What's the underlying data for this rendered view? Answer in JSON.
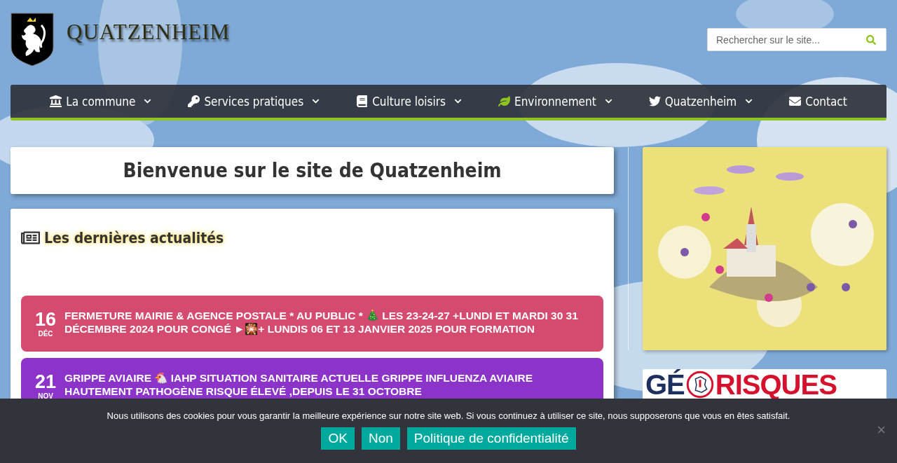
{
  "header": {
    "site_title": "QUATZENHEIM",
    "search": {
      "placeholder": "Rechercher sur le site..."
    }
  },
  "nav": [
    {
      "label": "La commune",
      "dropdown": true
    },
    {
      "label": "Services pratiques",
      "dropdown": true
    },
    {
      "label": "Culture loisirs",
      "dropdown": true
    },
    {
      "label": "Environnement",
      "dropdown": true
    },
    {
      "label": "Quatzenheim",
      "dropdown": true
    },
    {
      "label": "Contact",
      "dropdown": false
    }
  ],
  "welcome": {
    "heading": "Bienvenue sur le site de Quatzenheim"
  },
  "news": {
    "heading": "Les dernières actualités",
    "items": [
      {
        "day": "16",
        "month": "DÉC",
        "title": "FERMETURE MAIRIE & AGENCE POSTALE * AU PUBLIC * 🎄 LES 23-24-27 +LUNDI ET MARDI 30 31 DÉCEMBRE 2024 POUR CONGÉ ►🎇+ LUNDIS 06 ET 13 JANVIER 2025 POUR FORMATION",
        "color": "#d54a6f"
      },
      {
        "day": "21",
        "month": "NOV",
        "title": "GRIPPE AVIAIRE 🐔 IAHP SITUATION SANITAIRE ACTUELLE GRIPPE INFLUENZA AVIAIRE HAUTEMENT PATHOGÈNE RISQUE ÉLEVÉ ,DEPUIS LE 31 OCTOBRE",
        "color": "#8c33c9"
      }
    ]
  },
  "sidebar": {
    "logo": {
      "part_1": "GÉ",
      "part_2": "RISQUES"
    }
  },
  "cookie_banner": {
    "text": "Nous utilisons des cookies pour vous garantir la meilleure expérience sur notre site web. Si vous continuez à utiliser ce site, nous supposerons que vous en êtes satisfait.",
    "buttons": [
      "OK",
      "Non",
      "Politique de confidentialité"
    ],
    "close": "×"
  }
}
